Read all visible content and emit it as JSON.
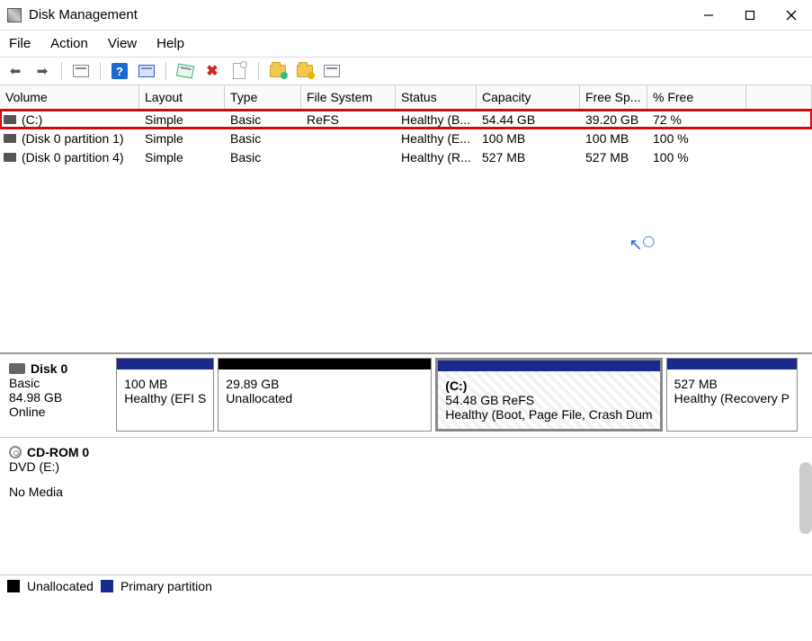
{
  "window_title": "Disk Management",
  "menu": {
    "file": "File",
    "action": "Action",
    "view": "View",
    "help": "Help"
  },
  "columns": {
    "volume": "Volume",
    "layout": "Layout",
    "type": "Type",
    "fs": "File System",
    "status": "Status",
    "capacity": "Capacity",
    "free": "Free Sp...",
    "pctfree": "% Free"
  },
  "rows": [
    {
      "volume": "(C:)",
      "layout": "Simple",
      "type": "Basic",
      "fs": "ReFS",
      "status": "Healthy (B...",
      "capacity": "54.44 GB",
      "free": "39.20 GB",
      "pctfree": "72 %"
    },
    {
      "volume": "(Disk 0 partition 1)",
      "layout": "Simple",
      "type": "Basic",
      "fs": "",
      "status": "Healthy (E...",
      "capacity": "100 MB",
      "free": "100 MB",
      "pctfree": "100 %"
    },
    {
      "volume": "(Disk 0 partition 4)",
      "layout": "Simple",
      "type": "Basic",
      "fs": "",
      "status": "Healthy (R...",
      "capacity": "527 MB",
      "free": "527 MB",
      "pctfree": "100 %"
    }
  ],
  "disk0": {
    "name": "Disk 0",
    "type": "Basic",
    "size": "84.98 GB",
    "state": "Online",
    "parts": [
      {
        "title": "",
        "line1": "100 MB",
        "line2": "Healthy (EFI S"
      },
      {
        "title": "",
        "line1": "29.89 GB",
        "line2": "Unallocated"
      },
      {
        "title": "(C:)",
        "line1": "54.48 GB ReFS",
        "line2": "Healthy (Boot, Page File, Crash Dum"
      },
      {
        "title": "",
        "line1": "527 MB",
        "line2": "Healthy (Recovery P"
      }
    ]
  },
  "cdrom": {
    "name": "CD-ROM 0",
    "desc": "DVD (E:)",
    "state": "No Media"
  },
  "legend": {
    "unallocated": "Unallocated",
    "primary": "Primary partition"
  }
}
